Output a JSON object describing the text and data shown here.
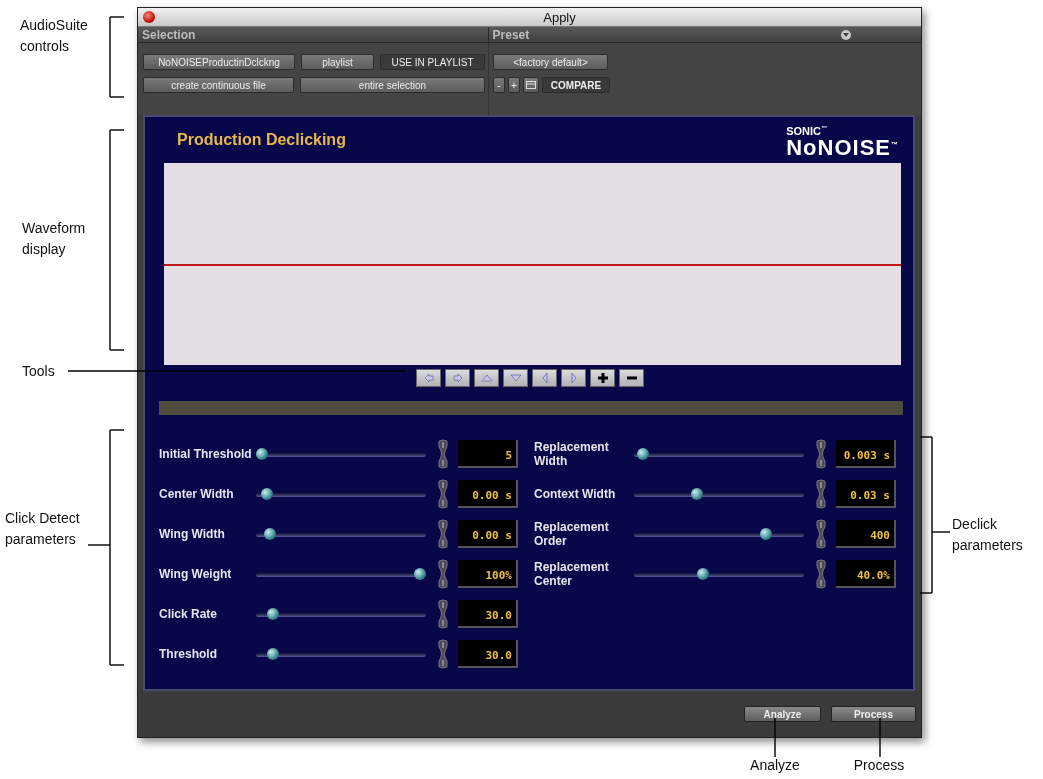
{
  "window": {
    "title": "Apply"
  },
  "selection": {
    "header": "Selection",
    "buttons": [
      "NoNOISEProductinDclckng",
      "playlist",
      "USE IN PLAYLIST",
      "create continuous file",
      "entire selection"
    ]
  },
  "preset": {
    "header": "Preset",
    "name": "<factory default>",
    "minus": "-",
    "plus": "+",
    "compare": "COMPARE"
  },
  "plugin": {
    "title": "Production Declicking",
    "logo_top": "SONIC$^{™}$",
    "logo_name": "NoNOISE$^{™}$"
  },
  "click_detect": [
    {
      "label": "Initial Threshold",
      "level": 0,
      "value": "5"
    },
    {
      "label": "Center Width",
      "level": 0.03,
      "value": "0.00 s"
    },
    {
      "label": "Wing Width",
      "level": 0.05,
      "value": "0.00 s"
    },
    {
      "label": "Wing Weight",
      "level": 1,
      "value": "100%"
    },
    {
      "label": "Click Rate",
      "level": 0.07,
      "value": "30.0"
    },
    {
      "label": "Threshold",
      "level": 0.07,
      "value": "30.0"
    }
  ],
  "declick": [
    {
      "label": "Replacement Width",
      "level": 0.02,
      "value": "0.003 s"
    },
    {
      "label": "Context Width",
      "level": 0.36,
      "value": "0.03 s"
    },
    {
      "label": "Replacement Order",
      "level": 0.8,
      "value": "400"
    },
    {
      "label": "Replacement Center",
      "level": 0.4,
      "value": "40.0%"
    }
  ],
  "footer": {
    "buttons": [
      "Analyze",
      "Process"
    ]
  },
  "callouts": [
    {
      "text": "AudioSuite controls"
    },
    {
      "text": "Waveform display"
    },
    {
      "text": "Tools"
    },
    {
      "text": "Click Detect parameters"
    },
    {
      "text": "Declick parameters"
    },
    {
      "text": "Analyze"
    },
    {
      "text": "Process"
    }
  ]
}
